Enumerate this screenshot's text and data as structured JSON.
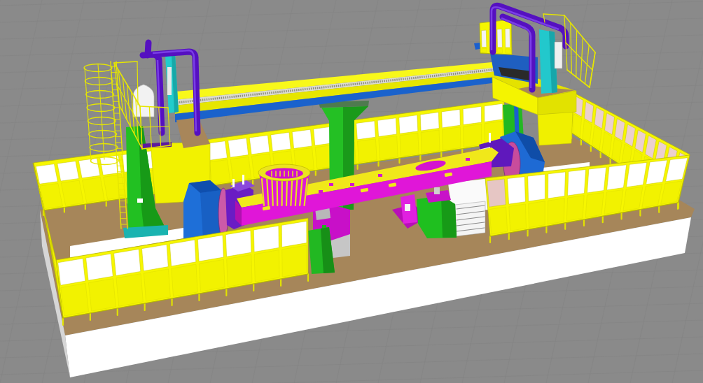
{
  "viewport": {
    "parts": [
      {
        "kind": "platform"
      },
      {
        "kind": "fence"
      },
      {
        "kind": "fence"
      },
      {
        "kind": "column"
      },
      {
        "kind": "column"
      },
      {
        "kind": "column"
      },
      {
        "kind": "beam"
      },
      {
        "kind": "carriage"
      },
      {
        "kind": "ladder"
      },
      {
        "kind": "carriage"
      },
      {
        "kind": "positioner"
      },
      {
        "kind": "positioner"
      },
      {
        "kind": "stand"
      },
      {
        "kind": "stand"
      },
      {
        "kind": "pedestal"
      },
      {
        "kind": "fixture"
      },
      {
        "kind": "workpiece"
      },
      {
        "kind": "ring"
      },
      {
        "kind": "fence"
      },
      {
        "kind": "fence"
      },
      {
        "kind": "fence"
      }
    ]
  }
}
